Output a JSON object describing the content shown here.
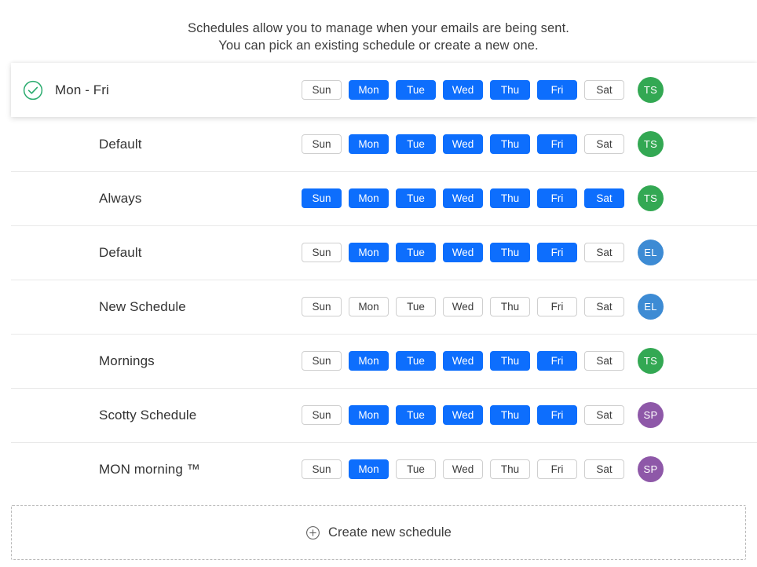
{
  "intro": {
    "line1": "Schedules allow you to manage when your emails are being sent.",
    "line2": "You can pick an existing schedule or create a new one."
  },
  "colors": {
    "day_on_bg": "#0d6efd",
    "day_off_border": "#cfcfcf",
    "check_green": "#2aab6e",
    "avatar_green": "#33a853",
    "avatar_blue": "#3d8bd4",
    "avatar_purple": "#8e58a8",
    "divider": "#e9e9e9"
  },
  "day_labels": [
    "Sun",
    "Mon",
    "Tue",
    "Wed",
    "Thu",
    "Fri",
    "Sat"
  ],
  "schedules": [
    {
      "name": "Mon - Fri",
      "selected": true,
      "check_icon": "check-circle-icon",
      "days": [
        false,
        true,
        true,
        true,
        true,
        true,
        false
      ],
      "avatar": {
        "initials": "TS",
        "color": "#33a853"
      }
    },
    {
      "name": "Default",
      "selected": false,
      "days": [
        false,
        true,
        true,
        true,
        true,
        true,
        false
      ],
      "avatar": {
        "initials": "TS",
        "color": "#33a853"
      }
    },
    {
      "name": "Always",
      "selected": false,
      "days": [
        true,
        true,
        true,
        true,
        true,
        true,
        true
      ],
      "avatar": {
        "initials": "TS",
        "color": "#33a853"
      }
    },
    {
      "name": "Default",
      "selected": false,
      "days": [
        false,
        true,
        true,
        true,
        true,
        true,
        false
      ],
      "avatar": {
        "initials": "EL",
        "color": "#3d8bd4"
      }
    },
    {
      "name": "New Schedule",
      "selected": false,
      "days": [
        false,
        false,
        false,
        false,
        false,
        false,
        false
      ],
      "avatar": {
        "initials": "EL",
        "color": "#3d8bd4"
      }
    },
    {
      "name": "Mornings",
      "selected": false,
      "days": [
        false,
        true,
        true,
        true,
        true,
        true,
        false
      ],
      "avatar": {
        "initials": "TS",
        "color": "#33a853"
      }
    },
    {
      "name": "Scotty Schedule",
      "selected": false,
      "days": [
        false,
        true,
        true,
        true,
        true,
        true,
        false
      ],
      "avatar": {
        "initials": "SP",
        "color": "#8e58a8"
      }
    },
    {
      "name": "MON morning ™",
      "selected": false,
      "days": [
        false,
        true,
        false,
        false,
        false,
        false,
        false
      ],
      "avatar": {
        "initials": "SP",
        "color": "#8e58a8"
      }
    }
  ],
  "create_new": {
    "label": "Create new schedule",
    "icon": "plus-circle-icon"
  }
}
